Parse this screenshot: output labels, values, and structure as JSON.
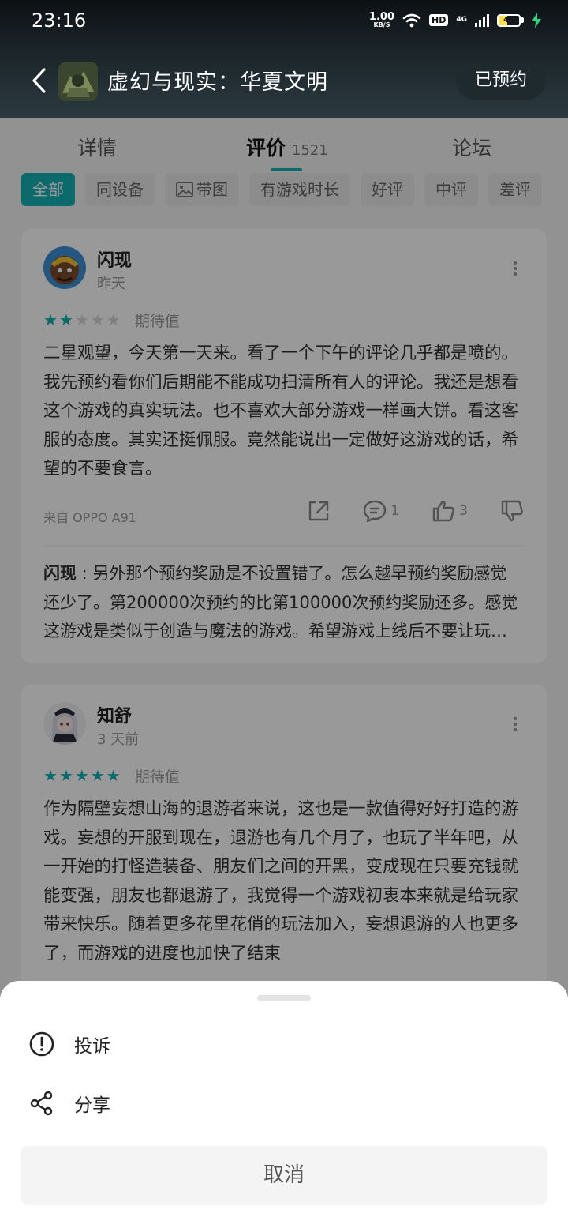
{
  "status_bar": {
    "time": "23:16",
    "net_speed": "1.00",
    "net_speed_unit": "KB/S",
    "hd": "HD",
    "network": "4G",
    "battery": "41",
    "battery_level": 0.41
  },
  "header": {
    "title": "虚幻与现实：华夏文明",
    "reserve_label": "已预约"
  },
  "tabs": [
    {
      "label": "详情"
    },
    {
      "label": "评价",
      "count": "1521"
    },
    {
      "label": "论坛"
    }
  ],
  "filters": [
    "全部",
    "同设备",
    "带图",
    "有游戏时长",
    "好评",
    "中评",
    "差评"
  ],
  "reviews": [
    {
      "user": "闪现",
      "date": "昨天",
      "stars": 2,
      "tag": "期待值",
      "content": "二星观望，今天第一天来。看了一个下午的评论几乎都是喷的。我先预约看你们后期能不能成功扫清所有人的评论。我还是想看这个游戏的真实玩法。也不喜欢大部分游戏一样画大饼。看这客服的态度。其实还挺佩服。竟然能说出一定做好这游戏的话，希望的不要食言。",
      "device": "来自 OPPO A91",
      "comments": "1",
      "likes": "3",
      "reply_user": "闪现",
      "reply_sep": " : ",
      "reply_text": "另外那个预约奖励是不设置错了。怎么越早预约奖励感觉还少了。第200000次预约的比第100000次预约奖励还多。感觉这游戏是类似于创造与魔法的游戏。希望游戏上线后不要让玩家失望。"
    },
    {
      "user": "知舒",
      "date": "3 天前",
      "stars": 5,
      "tag": "期待值",
      "content": "作为隔壁妄想山海的退游者来说，这也是一款值得好好打造的游戏。妄想的开服到现在，退游也有几个月了，也玩了半年吧，从一开始的打怪造装备、朋友们之间的开黑，变成现在只要充钱就能变强，朋友也都退游了，我觉得一个游戏初衷本来就是给玩家带来快乐。随着更多花里花俏的玩法加入，妄想退游的人也更多了，而游戏的进度也加快了结束"
    }
  ],
  "sheet": {
    "report_label": "投诉",
    "share_label": "分享",
    "cancel_label": "取消"
  },
  "colors": {
    "accent": "#14b1b4"
  }
}
